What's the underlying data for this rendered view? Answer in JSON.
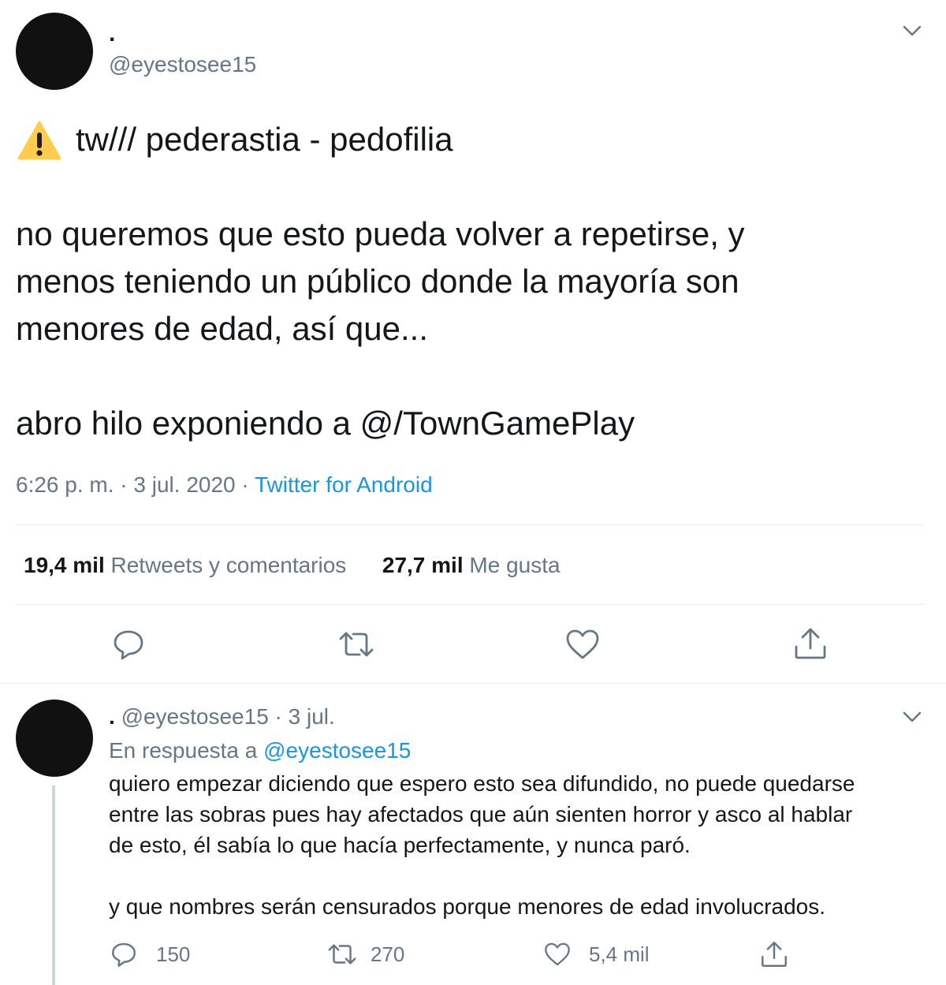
{
  "main_tweet": {
    "display_name": ".",
    "handle": "@eyestosee15",
    "warning_emoji": "⚠️",
    "line_warning": "tw/// pederastia - pedofilia",
    "para1_line1": "no queremos que esto pueda volver a repetirse, y",
    "para1_line2": "menos teniendo un público donde la mayoría son",
    "para1_line3": "menores de edad, así que...",
    "para2": "abro hilo exponiendo a @/TownGamePlay",
    "time": "6:26 p. m. · 3 jul. 2020 · ",
    "source": "Twitter for Android",
    "retweets_count": "19,4 mil",
    "retweets_label": "Retweets y comentarios",
    "likes_count": "27,7 mil",
    "likes_label": "Me gusta"
  },
  "reply_tweet": {
    "display_name": ".",
    "meta": "@eyestosee15 · 3 jul.",
    "in_reply_prefix": "En respuesta a ",
    "in_reply_handle": "@eyestosee15",
    "line1": "quiero empezar diciendo que espero esto sea difundido, no puede quedarse",
    "line2": "entre las sobras pues hay afectados que aún sienten horror y asco al hablar",
    "line3": "de esto, él sabía lo que hacía perfectamente, y nunca paró.",
    "line4": "y que nombres serán censurados porque menores de edad involucrados.",
    "reply_count": "150",
    "retweet_count": "270",
    "like_count": "5,4 mil"
  },
  "icons": {
    "chevron": "chevron-down-icon",
    "reply": "reply-icon",
    "retweet": "retweet-icon",
    "like": "heart-icon",
    "share": "share-icon"
  },
  "colors": {
    "text": "#14171a",
    "muted": "#657786",
    "link": "#1b95e0",
    "divider": "#e6ecf0",
    "avatar": "#111111"
  }
}
